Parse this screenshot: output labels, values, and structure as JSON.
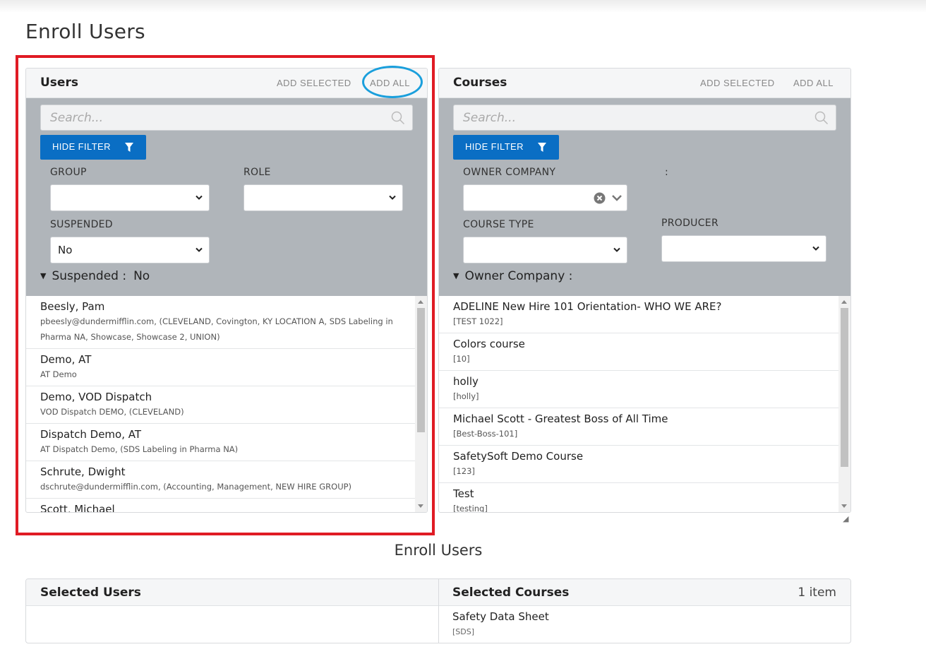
{
  "page": {
    "title": "Enroll Users"
  },
  "users_panel": {
    "title": "Users",
    "add_selected": "ADD SELECTED",
    "add_all": "ADD ALL",
    "search_placeholder": "Search...",
    "hide_filter": "HIDE FILTER",
    "filters": {
      "group_label": "GROUP",
      "group_value": "",
      "role_label": "ROLE",
      "role_value": "",
      "suspended_label": "SUSPENDED",
      "suspended_value": "No"
    },
    "active_filter": {
      "label": "Suspended :",
      "value": "No"
    },
    "items": [
      {
        "name": "Beesly, Pam",
        "detail": "pbeesly@dundermifflin.com, (CLEVELAND, Covington, KY LOCATION A, SDS Labeling in Pharma NA, Showcase, Showcase 2, UNION)"
      },
      {
        "name": "Demo, AT",
        "detail": "AT Demo"
      },
      {
        "name": "Demo, VOD Dispatch",
        "detail": "VOD Dispatch DEMO, (CLEVELAND)"
      },
      {
        "name": "Dispatch Demo, AT",
        "detail": "AT Dispatch Demo, (SDS Labeling in Pharma NA)"
      },
      {
        "name": "Schrute, Dwight",
        "detail": "dschrute@dundermifflin.com, (Accounting, Management, NEW HIRE GROUP)"
      },
      {
        "name": "Scott, Michael",
        "detail": ""
      }
    ]
  },
  "courses_panel": {
    "title": "Courses",
    "add_selected": "ADD SELECTED",
    "add_all": "ADD ALL",
    "search_placeholder": "Search...",
    "hide_filter": "HIDE FILTER",
    "filters": {
      "owner_company_label": "OWNER COMPANY",
      "owner_company_value": "",
      "colon": ":",
      "course_type_label": "COURSE TYPE",
      "course_type_value": "",
      "producer_label": "PRODUCER",
      "producer_value": ""
    },
    "active_filter": {
      "label": "Owner Company :",
      "value": ""
    },
    "items": [
      {
        "name": "ADELINE New Hire 101 Orientation- WHO WE ARE?",
        "detail": "[TEST 1022]"
      },
      {
        "name": "Colors course",
        "detail": "[10]"
      },
      {
        "name": "holly",
        "detail": "[holly]"
      },
      {
        "name": "Michael Scott - Greatest Boss of All Time",
        "detail": "[Best-Boss-101]"
      },
      {
        "name": "SafetySoft Demo Course",
        "detail": "[123]"
      },
      {
        "name": "Test",
        "detail": "[testing]"
      }
    ]
  },
  "enroll": {
    "title": "Enroll Users",
    "selected_users_title": "Selected Users",
    "selected_courses_title": "Selected Courses",
    "selected_courses_count": "1 item",
    "selected_courses": [
      {
        "name": "Safety Data Sheet",
        "detail": "[SDS]"
      }
    ]
  },
  "colors": {
    "accent": "#0a6ec4",
    "filter_bg": "#b0b5ba",
    "highlight_red": "#e01b24",
    "highlight_blue": "#1a9fdc"
  }
}
